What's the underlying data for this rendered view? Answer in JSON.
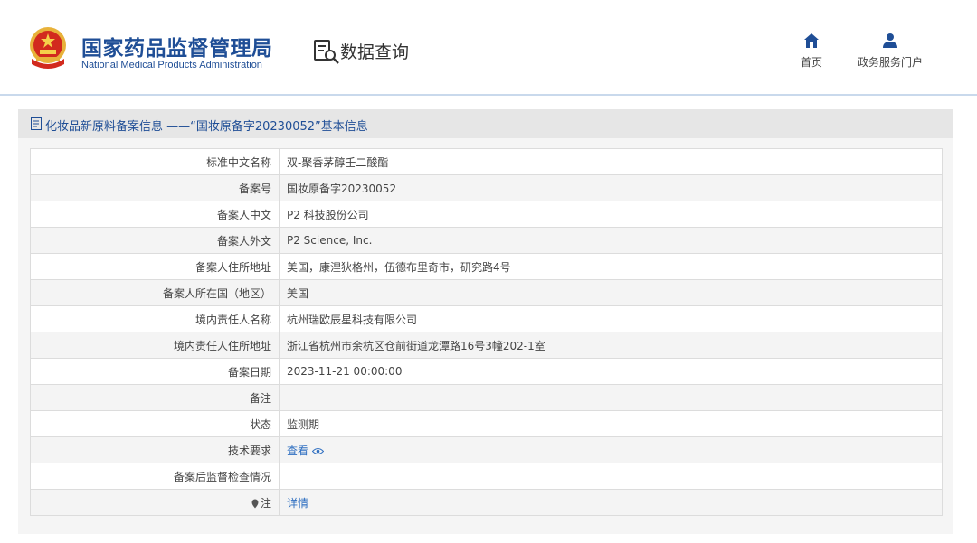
{
  "header": {
    "brand_cn": "国家药品监督管理局",
    "brand_en": "National Medical Products Administration",
    "query_title": "数据查询",
    "nav": [
      {
        "label": "首页",
        "icon": "home-icon"
      },
      {
        "label": "政务服务门户",
        "icon": "user-icon"
      }
    ]
  },
  "section": {
    "title": "化妆品新原料备案信息 ——“国妆原备字20230052”基本信息"
  },
  "table": {
    "rows": [
      {
        "label": "标准中文名称",
        "value": "双-聚香茅醇壬二酸酯"
      },
      {
        "label": "备案号",
        "value": "国妆原备字20230052"
      },
      {
        "label": "备案人中文",
        "value": "P2 科技股份公司"
      },
      {
        "label": "备案人外文",
        "value": "P2 Science, Inc."
      },
      {
        "label": "备案人住所地址",
        "value": "美国，康涅狄格州，伍德布里奇市，研究路4号"
      },
      {
        "label": "备案人所在国（地区）",
        "value": "美国"
      },
      {
        "label": "境内责任人名称",
        "value": "杭州瑞欧辰星科技有限公司"
      },
      {
        "label": "境内责任人住所地址",
        "value": "浙江省杭州市余杭区仓前街道龙潭路16号3幢202-1室"
      },
      {
        "label": "备案日期",
        "value": "2023-11-21 00:00:00"
      },
      {
        "label": "备注",
        "value": ""
      },
      {
        "label": "状态",
        "value": "监测期"
      },
      {
        "label": "技术要求",
        "link": "查看"
      },
      {
        "label": "备案后监督检查情况",
        "value": ""
      },
      {
        "label": "注",
        "link": "详情"
      }
    ]
  },
  "colors": {
    "brand_blue": "#1f4e96",
    "link_blue": "#2f6fc1",
    "section_bg": "#e6e6e6"
  }
}
